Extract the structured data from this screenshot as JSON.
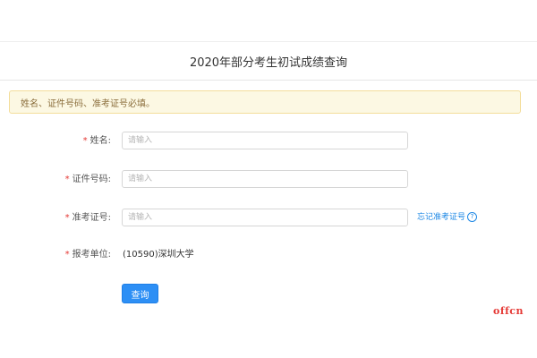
{
  "header": {
    "title": "2020年部分考生初试成绩查询"
  },
  "alert": {
    "text": "姓名、证件号码、准考证号必填。"
  },
  "form": {
    "required_mark": "*",
    "name": {
      "label": "姓名:",
      "placeholder": "请输入",
      "value": ""
    },
    "id_number": {
      "label": "证件号码:",
      "placeholder": "请输入",
      "value": ""
    },
    "exam_number": {
      "label": "准考证号:",
      "placeholder": "请输入",
      "value": "",
      "forgot_link": "忘记准考证号",
      "help_icon": "?"
    },
    "institution": {
      "label": "报考单位:",
      "value": "(10590)深圳大学"
    },
    "submit_label": "查询"
  },
  "watermark": {
    "text": "offcn"
  },
  "colors": {
    "accent": "#2d8ff5",
    "link": "#1e88e5",
    "required": "#e53935",
    "alert_bg": "#fcf8e3",
    "alert_text": "#8a6d3b"
  }
}
